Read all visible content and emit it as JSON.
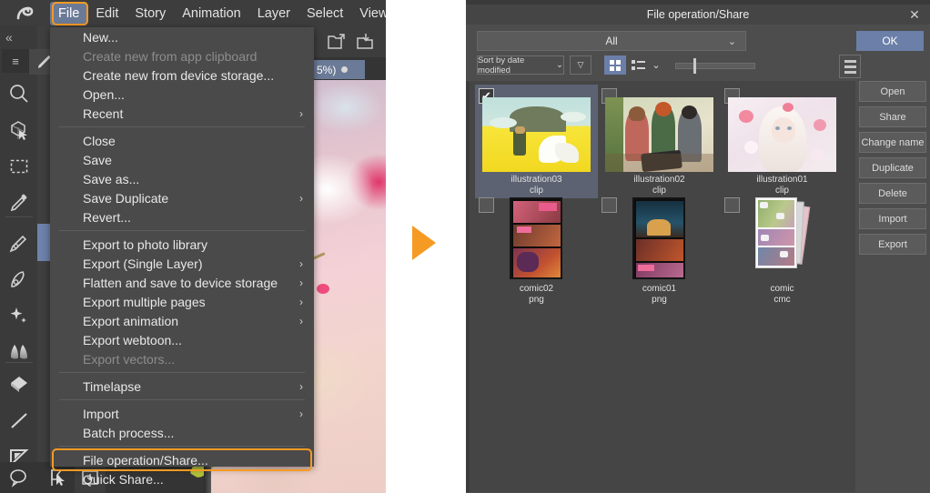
{
  "app": {
    "menubar": [
      "File",
      "Edit",
      "Story",
      "Animation",
      "Layer",
      "Select",
      "View"
    ],
    "active_menu": "File",
    "zoom_chip": "5%)",
    "collapse_label": "«",
    "hamburger_label": "≡"
  },
  "file_menu": {
    "items": [
      {
        "label": "New...",
        "submenu": false,
        "disabled": false
      },
      {
        "label": "Create new from app clipboard",
        "submenu": false,
        "disabled": true
      },
      {
        "label": "Create new from device storage...",
        "submenu": false,
        "disabled": false
      },
      {
        "label": "Open...",
        "submenu": false,
        "disabled": false
      },
      {
        "label": "Recent",
        "submenu": true,
        "disabled": false
      },
      {
        "separator": true
      },
      {
        "label": "Close",
        "submenu": false,
        "disabled": false
      },
      {
        "label": "Save",
        "submenu": false,
        "disabled": false
      },
      {
        "label": "Save as...",
        "submenu": false,
        "disabled": false
      },
      {
        "label": "Save Duplicate",
        "submenu": true,
        "disabled": false
      },
      {
        "label": "Revert...",
        "submenu": false,
        "disabled": false
      },
      {
        "separator": true
      },
      {
        "label": "Export to photo library",
        "submenu": false,
        "disabled": false
      },
      {
        "label": "Export (Single Layer)",
        "submenu": true,
        "disabled": false
      },
      {
        "label": "Flatten and save to device storage",
        "submenu": true,
        "disabled": false
      },
      {
        "label": "Export multiple pages",
        "submenu": true,
        "disabled": false
      },
      {
        "label": "Export animation",
        "submenu": true,
        "disabled": false
      },
      {
        "label": "Export webtoon...",
        "submenu": false,
        "disabled": false
      },
      {
        "label": "Export vectors...",
        "submenu": false,
        "disabled": true
      },
      {
        "separator": true
      },
      {
        "label": "Timelapse",
        "submenu": true,
        "disabled": false
      },
      {
        "separator": true
      },
      {
        "label": "Import",
        "submenu": true,
        "disabled": false
      },
      {
        "label": "Batch process...",
        "submenu": false,
        "disabled": false
      },
      {
        "separator": true
      },
      {
        "label": "File operation/Share...",
        "submenu": false,
        "disabled": false,
        "highlighted": true
      },
      {
        "label": "Quick Share...",
        "submenu": false,
        "disabled": false
      }
    ]
  },
  "tools": [
    {
      "name": "magnifier-tool",
      "glyph": "search"
    },
    {
      "name": "object-tool",
      "glyph": "object"
    },
    {
      "name": "selection-tool",
      "glyph": "marquee"
    },
    {
      "name": "eyedropper-tool",
      "glyph": "dropper"
    },
    {
      "name": "pen-tool",
      "glyph": "pen"
    },
    {
      "name": "brush-tool",
      "glyph": "brush"
    },
    {
      "name": "decoration-tool",
      "glyph": "sparkle"
    },
    {
      "name": "blend-tool",
      "glyph": "blend"
    },
    {
      "name": "fill-tool",
      "glyph": "fill"
    },
    {
      "name": "line-tool",
      "glyph": "line"
    },
    {
      "name": "ruler-tool",
      "glyph": "ruler"
    },
    {
      "name": "balloon-tool",
      "glyph": "balloon"
    }
  ],
  "dialog": {
    "title": "File operation/Share",
    "close_label": "✕",
    "filter": {
      "value": "All",
      "chevron": "⌄"
    },
    "ok_label": "OK",
    "sort": {
      "value": "Sort by date modified",
      "chevron": "⌄"
    },
    "sort_dir_glyph": "▽",
    "view_chevron": "⌄",
    "buttons": [
      "Open",
      "Share",
      "Change name",
      "Duplicate",
      "Delete",
      "Import",
      "Export"
    ],
    "files": [
      {
        "name": "illustration03",
        "ext": "clip",
        "selected": true,
        "kind": "landscape"
      },
      {
        "name": "illustration02",
        "ext": "clip",
        "selected": false,
        "kind": "people"
      },
      {
        "name": "illustration01",
        "ext": "clip",
        "selected": false,
        "kind": "portrait"
      },
      {
        "name": "comic02",
        "ext": "png",
        "selected": false,
        "kind": "comic-red"
      },
      {
        "name": "comic01",
        "ext": "png",
        "selected": false,
        "kind": "comic-night"
      },
      {
        "name": "comic",
        "ext": "cmc",
        "selected": false,
        "kind": "comic-stack"
      }
    ],
    "checkmark": "✔"
  },
  "colors": {
    "accent_orange": "#f59a23",
    "accent_blue": "#6b7fa8",
    "menu_bg": "#4a4a4a",
    "dialog_bg": "#4d4d4d",
    "panel_bg": "#343434"
  }
}
